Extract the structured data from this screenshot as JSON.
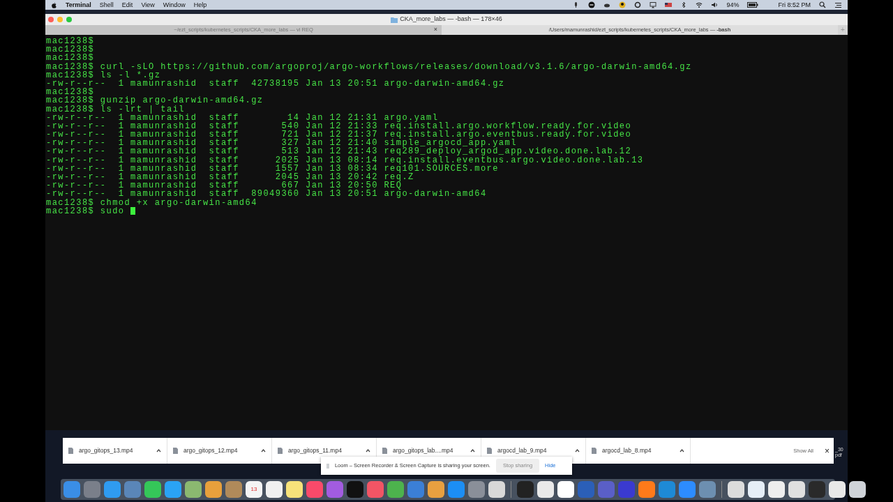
{
  "menu_bar": {
    "app_name": "Terminal",
    "menus": [
      "Shell",
      "Edit",
      "View",
      "Window",
      "Help"
    ],
    "battery_percent": "94%",
    "clock": "Fri 8:52 PM"
  },
  "window": {
    "title": "CKA_more_labs — -bash — 178×46"
  },
  "tabs": [
    {
      "label": "~/ezt_scripts/kubernetes_scripts/CKA_more_labs — vi REQ",
      "selected": false,
      "close": "×"
    },
    {
      "label": "/Users/mamunrashid/ezt_scripts/kubernetes_scripts/CKA_more_labs — **-bash**",
      "selected": true
    }
  ],
  "new_tab": "+",
  "terminal": {
    "cursor": true,
    "lines": [
      "mac1238$",
      "mac1238$",
      "mac1238$",
      "mac1238$ curl -sLO https://github.com/argoproj/argo-workflows/releases/download/v3.1.6/argo-darwin-amd64.gz",
      "mac1238$ ls -l *.gz",
      "-rw-r--r--  1 mamunrashid  staff  42738195 Jan 13 20:51 argo-darwin-amd64.gz",
      "mac1238$",
      "mac1238$ gunzip argo-darwin-amd64.gz",
      "mac1238$ ls -lrt | tail",
      "-rw-r--r--  1 mamunrashid  staff        14 Jan 12 21:31 argo.yaml",
      "-rw-r--r--  1 mamunrashid  staff       540 Jan 12 21:33 req.install.argo.workflow.ready.for.video",
      "-rw-r--r--  1 mamunrashid  staff       721 Jan 12 21:37 req.install.argo.eventbus.ready.for.video",
      "-rw-r--r--  1 mamunrashid  staff       327 Jan 12 21:40 simple_argocd_app.yaml",
      "-rw-r--r--  1 mamunrashid  staff       513 Jan 12 21:43 req289_deploy_argod_app.video.done.lab.12",
      "-rw-r--r--  1 mamunrashid  staff      2025 Jan 13 08:14 req.install.eventbus.argo.video.done.lab.13",
      "-rw-r--r--  1 mamunrashid  staff      1557 Jan 13 08:34 req101.SOURCES.more",
      "-rw-r--r--  1 mamunrashid  staff      2045 Jan 13 20:42 req.Z",
      "-rw-r--r--  1 mamunrashid  staff       667 Jan 13 20:50 REQ",
      "-rw-r--r--  1 mamunrashid  staff  89049360 Jan 13 20:51 argo-darwin-amd64",
      "mac1238$ chmod +x argo-darwin-amd64",
      "mac1238$ sudo "
    ]
  },
  "downloads": {
    "items": [
      "argo_gitops_13.mp4",
      "argo_gitops_12.mp4",
      "argo_gitops_11.mp4",
      "argo_gitops_lab....mp4",
      "argocd_lab_9.mp4",
      "argocd_lab_8.mp4"
    ],
    "show_all": "Show All",
    "close": "×",
    "edge_text": [
      "_30",
      "pdf"
    ]
  },
  "sharing_banner": {
    "handle": "||",
    "message": "Loom – Screen Recorder & Screen Capture is sharing your screen.",
    "stop_button": "Stop sharing",
    "hide_link": "Hide"
  },
  "dock": [
    {
      "apps": [
        {
          "color": "#3a8ee6"
        },
        {
          "color": "#7a7f8a"
        },
        {
          "color": "#2f9bf0"
        },
        {
          "color": "#5a86b8"
        },
        {
          "color": "#35c759"
        },
        {
          "color": "#2aa3f5"
        },
        {
          "color": "#8bb870"
        },
        {
          "color": "#e8a03c"
        },
        {
          "color": "#b08a5a"
        },
        {
          "color": "#f4f4f4",
          "label": "13"
        },
        {
          "color": "#f0f0f0"
        },
        {
          "color": "#f7e27a"
        },
        {
          "color": "#fa4a6a"
        },
        {
          "color": "#a25ce0"
        },
        {
          "color": "#111111"
        },
        {
          "color": "#f25565"
        },
        {
          "color": "#4db34d"
        },
        {
          "color": "#3b7fd6"
        },
        {
          "color": "#e8a040"
        },
        {
          "color": "#1c8ef5"
        },
        {
          "color": "#8a8f99"
        },
        {
          "color": "#d8d8d8"
        }
      ]
    },
    {
      "apps": [
        {
          "color": "#222222"
        },
        {
          "color": "#e9e9e9"
        },
        {
          "color": "#ffffff"
        },
        {
          "color": "#2b5fb8"
        },
        {
          "color": "#5a5fc7"
        },
        {
          "color": "#3a3ad0"
        },
        {
          "color": "#ff7a1a"
        },
        {
          "color": "#1e8ad6"
        },
        {
          "color": "#2d8cff"
        },
        {
          "color": "#6d8fb0"
        }
      ]
    },
    {
      "apps": [
        {
          "color": "#dcdcdc"
        },
        {
          "color": "#e6eef7"
        },
        {
          "color": "#eeeeee"
        },
        {
          "color": "#e0e0e0"
        },
        {
          "color": "#2a2a2a"
        },
        {
          "color": "#e8e8e8"
        },
        {
          "color": "#cfd3d8"
        }
      ]
    }
  ]
}
